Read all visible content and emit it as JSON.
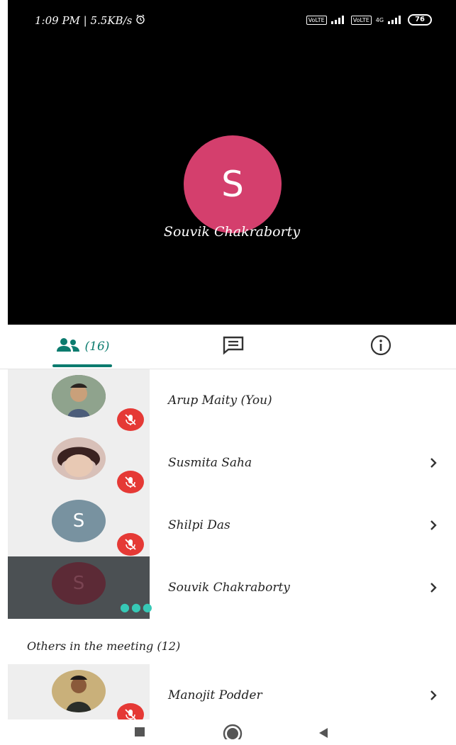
{
  "status_bar": {
    "time": "1:09 PM | 5.5KB/s",
    "alarm_icon": "alarm-icon",
    "sim1": "VoLTE",
    "sim2": "VoLTE",
    "network": "4G",
    "battery": "76"
  },
  "stage": {
    "speaker_initial": "S",
    "speaker_name": "Souvik Chakraborty",
    "avatar_color": "#d43f6d"
  },
  "tabs": {
    "people_icon": "people-icon",
    "people_count": "(16)",
    "chat_icon": "chat-icon",
    "info_icon": "info-icon",
    "accent": "#0b7b6e"
  },
  "participants": [
    {
      "name": "Arup Maity (You)",
      "avatar": "photo",
      "muted": true
    },
    {
      "name": "Susmita Saha",
      "avatar": "photo",
      "muted": true
    },
    {
      "name": "Shilpi Das",
      "avatar_letter": "S",
      "muted": true
    },
    {
      "name": "Souvik Chakraborty",
      "avatar_letter": "S",
      "muted": false,
      "speaking": true
    }
  ],
  "others": {
    "heading": "Others in the meeting (12)",
    "items": [
      {
        "name": "Manojit Podder",
        "avatar": "photo",
        "muted": true
      }
    ]
  },
  "nav": {
    "recent_icon": "square-icon",
    "home_icon": "circle-icon",
    "back_icon": "triangle-back-icon"
  }
}
